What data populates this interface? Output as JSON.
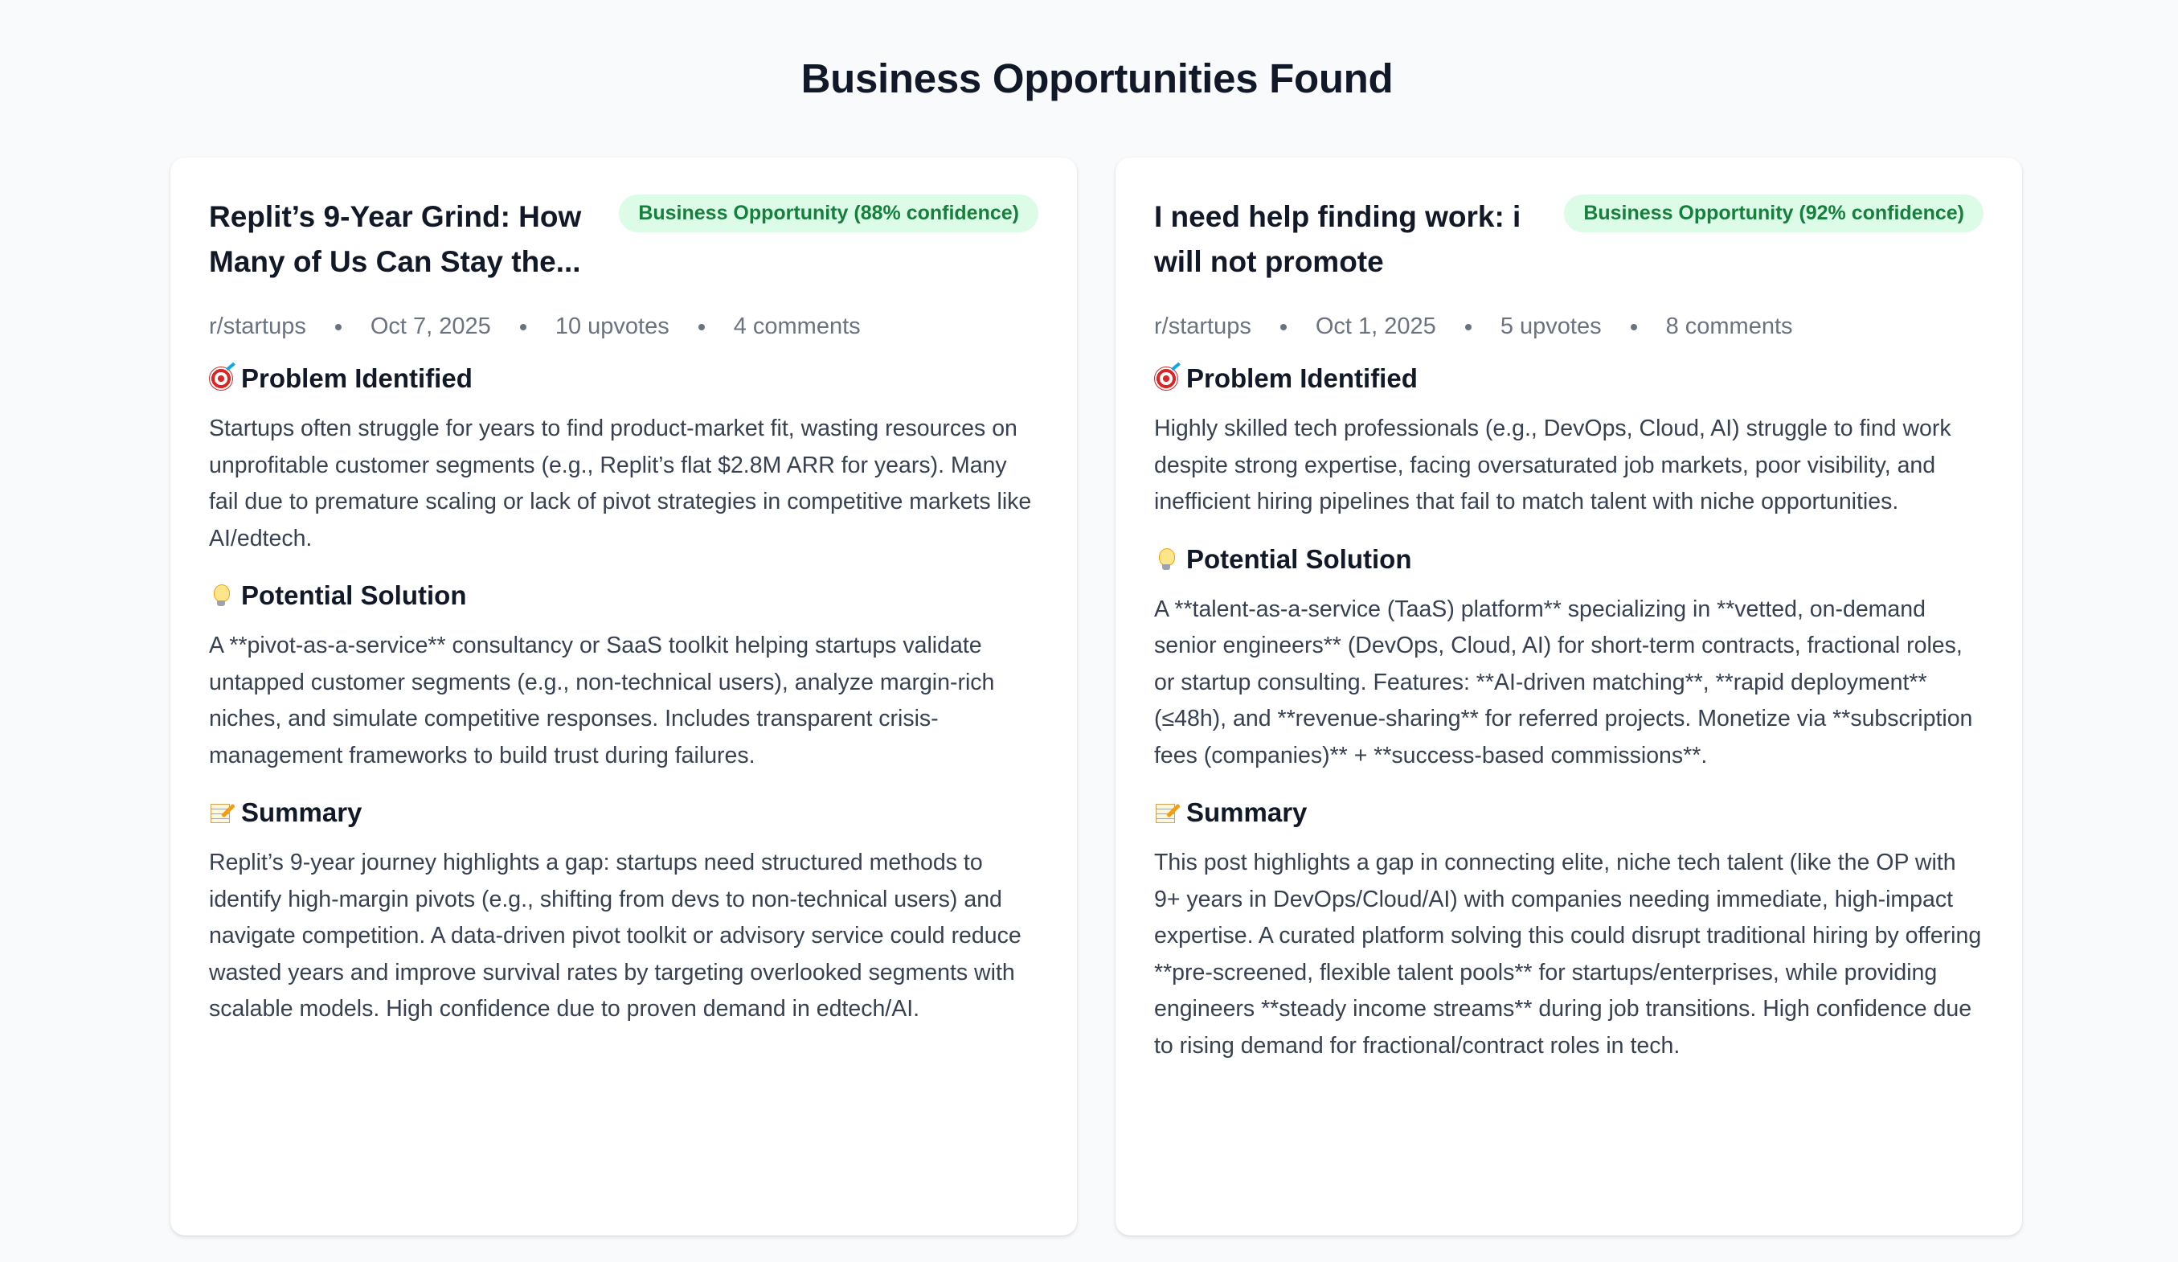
{
  "page": {
    "title": "Business Opportunities Found"
  },
  "cards": [
    {
      "title": "Replit’s 9-Year Grind: How Many of Us Can Stay the...",
      "badge": "Business Opportunity (88% confidence)",
      "subreddit": "r/startups",
      "date": "Oct 7, 2025",
      "upvotes": "10 upvotes",
      "comments": "4 comments",
      "sections": [
        {
          "icon": "target-icon",
          "title": "Problem Identified",
          "body": "Startups often struggle for years to find product-market fit, wasting resources on unprofitable customer segments (e.g., Replit’s flat $2.8M ARR for years). Many fail due to premature scaling or lack of pivot strategies in competitive markets like AI/edtech."
        },
        {
          "icon": "lightbulb-icon",
          "title": "Potential Solution",
          "body": "A **pivot-as-a-service** consultancy or SaaS toolkit helping startups validate untapped customer segments (e.g., non-technical users), analyze margin-rich niches, and simulate competitive responses. Includes transparent crisis-management frameworks to build trust during failures."
        },
        {
          "icon": "memo-icon",
          "title": "Summary",
          "body": "Replit’s 9-year journey highlights a gap: startups need structured methods to identify high-margin pivots (e.g., shifting from devs to non-technical users) and navigate competition. A data-driven pivot toolkit or advisory service could reduce wasted years and improve survival rates by targeting overlooked segments with scalable models. High confidence due to proven demand in edtech/AI."
        }
      ]
    },
    {
      "title": "I need help finding work: i will not promote",
      "badge": "Business Opportunity (92% confidence)",
      "subreddit": "r/startups",
      "date": "Oct 1, 2025",
      "upvotes": "5 upvotes",
      "comments": "8 comments",
      "sections": [
        {
          "icon": "target-icon",
          "title": "Problem Identified",
          "body": "Highly skilled tech professionals (e.g., DevOps, Cloud, AI) struggle to find work despite strong expertise, facing oversaturated job markets, poor visibility, and inefficient hiring pipelines that fail to match talent with niche opportunities."
        },
        {
          "icon": "lightbulb-icon",
          "title": "Potential Solution",
          "body": "A **talent-as-a-service (TaaS) platform** specializing in **vetted, on-demand senior engineers** (DevOps, Cloud, AI) for short-term contracts, fractional roles, or startup consulting. Features: **AI-driven matching**, **rapid deployment** (≤48h), and **revenue-sharing** for referred projects. Monetize via **subscription fees (companies)** + **success-based commissions**."
        },
        {
          "icon": "memo-icon",
          "title": "Summary",
          "body": "This post highlights a gap in connecting elite, niche tech talent (like the OP with 9+ years in DevOps/Cloud/AI) with companies needing immediate, high-impact expertise. A curated platform solving this could disrupt traditional hiring by offering **pre-screened, flexible talent pools** for startups/enterprises, while providing engineers **steady income streams** during job transitions. High confidence due to rising demand for fractional/contract roles in tech."
        }
      ]
    }
  ]
}
